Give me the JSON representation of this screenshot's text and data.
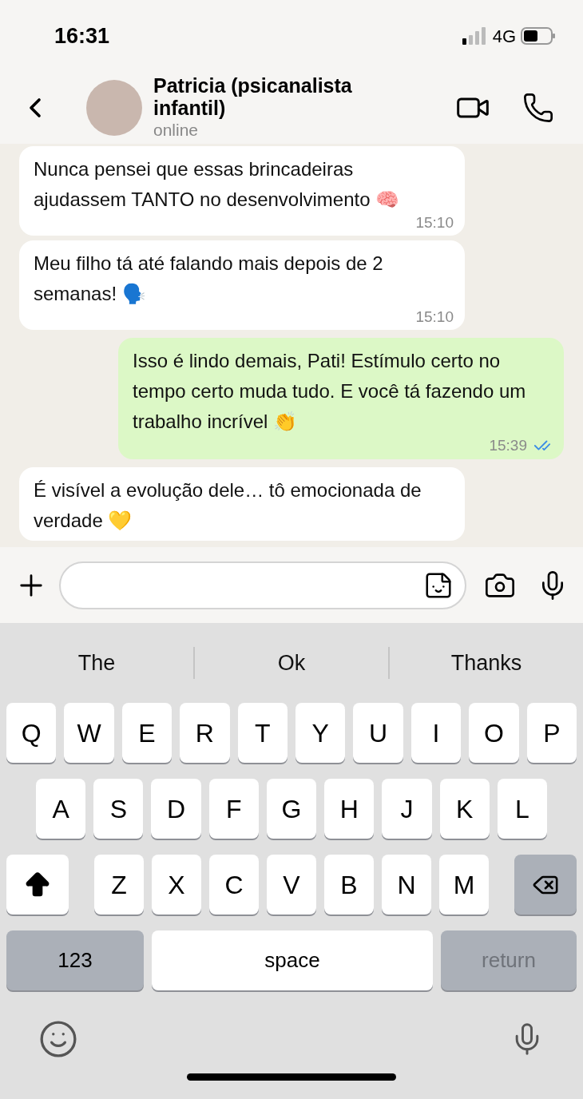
{
  "status_bar": {
    "time": "16:31",
    "network": "4G"
  },
  "header": {
    "name": "Patricia (psicanalista infantil)",
    "status": "online"
  },
  "messages": [
    {
      "kind": "received",
      "text": "Nunca pensei que essas brincadeiras ajudassem TANTO no desenvolvimento 🧠",
      "time": "15:10"
    },
    {
      "kind": "received",
      "text": "Meu filho tá até falando mais depois de 2 semanas! 🗣️",
      "time": "15:10"
    },
    {
      "kind": "sent",
      "text": "Isso é lindo demais, Pati! Estímulo certo no tempo certo muda tudo. E você tá fazendo um trabalho incrível 👏",
      "time": "15:39",
      "read": true
    },
    {
      "kind": "received",
      "text": "É visível a evolução dele… tô emocionada de verdade 💛"
    }
  ],
  "suggestions": [
    "The",
    "Ok",
    "Thanks"
  ],
  "keyboard": {
    "rows": [
      [
        "Q",
        "W",
        "E",
        "R",
        "T",
        "Y",
        "U",
        "I",
        "O",
        "P"
      ],
      [
        "A",
        "S",
        "D",
        "F",
        "G",
        "H",
        "J",
        "K",
        "L"
      ],
      [
        "Z",
        "X",
        "C",
        "V",
        "B",
        "N",
        "M"
      ]
    ],
    "shift_on": true,
    "numbers_key": "123",
    "space_key": "space",
    "return_key": {
      "label": "return",
      "disabled": true
    }
  }
}
